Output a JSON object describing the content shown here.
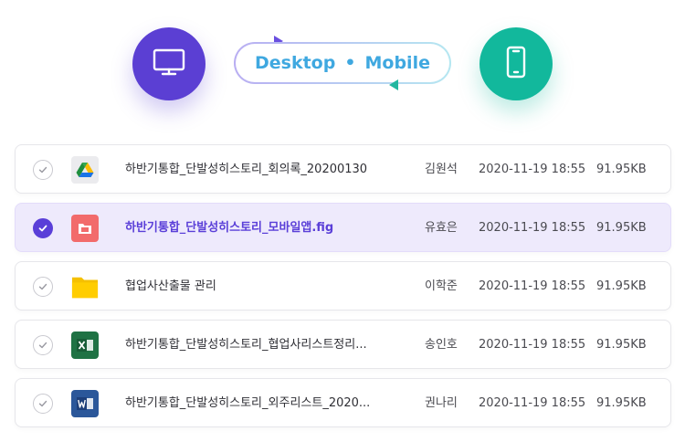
{
  "header": {
    "desktop_label": "Desktop",
    "mobile_label": "Mobile",
    "separator": "•",
    "desktop_icon": "monitor-icon",
    "mobile_icon": "smartphone-icon",
    "colors": {
      "desktop": "#5b3fd3",
      "mobile": "#12b89c",
      "pill_text": "#3fa8e0"
    }
  },
  "files": [
    {
      "name": "하반기통합_단발성히스토리_회의록_20200130",
      "owner": "김원석",
      "date": "2020-11-19 18:55",
      "size": "91.95KB",
      "icon": "google-drive-icon",
      "selected": false
    },
    {
      "name": "하반기통합_단발성히스토리_모바일앱.fig",
      "owner": "유효은",
      "date": "2020-11-19 18:55",
      "size": "91.95KB",
      "icon": "figma-file-icon",
      "selected": true
    },
    {
      "name": "협업사산출물 관리",
      "owner": "이학준",
      "date": "2020-11-19 18:55",
      "size": "91.95KB",
      "icon": "folder-icon",
      "selected": false
    },
    {
      "name": "하반기통합_단발성히스토리_협업사리스트정리...",
      "owner": "송인호",
      "date": "2020-11-19 18:55",
      "size": "91.95KB",
      "icon": "excel-file-icon",
      "selected": false
    },
    {
      "name": "하반기통합_단발성히스토리_외주리스트_2020...",
      "owner": "권나리",
      "date": "2020-11-19 18:55",
      "size": "91.95KB",
      "icon": "word-file-icon",
      "selected": false
    }
  ],
  "colors": {
    "accent": "#5a3fd8",
    "selected_row_bg": "#eeeafc"
  }
}
